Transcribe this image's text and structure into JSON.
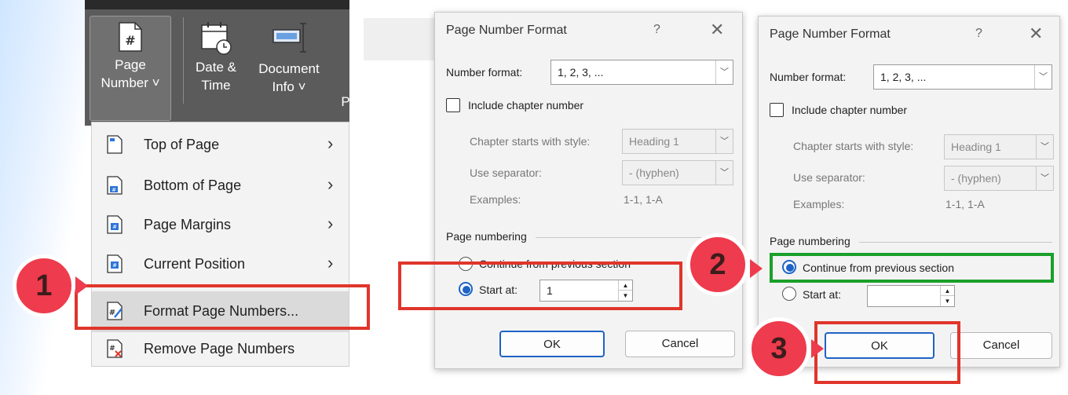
{
  "ribbon": {
    "page_number_btn": [
      "Page",
      "Number ˅"
    ],
    "date_time_btn": [
      "Date &",
      "Time"
    ],
    "document_info_btn": [
      "Document",
      "Info ˅"
    ],
    "partial_cut": "P"
  },
  "menu": {
    "items": [
      {
        "label": "Top of Page",
        "icon": "page-top-icon",
        "has_submenu": true
      },
      {
        "label": "Bottom of Page",
        "icon": "page-bottom-icon",
        "has_submenu": true
      },
      {
        "label": "Page Margins",
        "icon": "page-margins-icon",
        "has_submenu": true
      },
      {
        "label": "Current Position",
        "icon": "current-position-icon",
        "has_submenu": true
      },
      {
        "label": "Format Page Numbers...",
        "icon": "format-page-numbers-icon",
        "has_submenu": false
      },
      {
        "label": "Remove Page Numbers",
        "icon": "remove-page-numbers-icon",
        "has_submenu": false
      }
    ]
  },
  "dialog1": {
    "title": "Page Number Format",
    "help": "?",
    "close": "✕",
    "number_format_label": "Number format:",
    "number_format_value": "1, 2, 3, ...",
    "include_chapter_label": "Include chapter number",
    "chapter_starts_label": "Chapter starts with style:",
    "chapter_starts_value": "Heading 1",
    "separator_label": "Use separator:",
    "separator_value": "-   (hyphen)",
    "examples_label": "Examples:",
    "examples_value": "1-1, 1-A",
    "page_numbering_label": "Page numbering",
    "continue_label": "Continue from previous section",
    "start_at_label": "Start at:",
    "start_at_value": "1",
    "ok": "OK",
    "cancel": "Cancel"
  },
  "dialog2": {
    "title": "Page Number Format",
    "help": "?",
    "close": "✕",
    "number_format_label": "Number format:",
    "number_format_value": "1, 2, 3, ...",
    "include_chapter_label": "Include chapter number",
    "chapter_starts_label": "Chapter starts with style:",
    "chapter_starts_value": "Heading 1",
    "separator_label": "Use separator:",
    "separator_value": "-   (hyphen)",
    "examples_label": "Examples:",
    "examples_value": "1-1, 1-A",
    "page_numbering_label": "Page numbering",
    "continue_label": "Continue from previous section",
    "start_at_label": "Start at:",
    "start_at_value": "",
    "ok": "OK",
    "cancel": "Cancel"
  },
  "badges": {
    "step1": "1",
    "step2": "2",
    "step3": "3"
  },
  "colors": {
    "highlight_red": "#e0352b",
    "highlight_green": "#1aa02a",
    "badge_pink": "#ee3b4d",
    "accent_blue": "#1e63c4"
  }
}
